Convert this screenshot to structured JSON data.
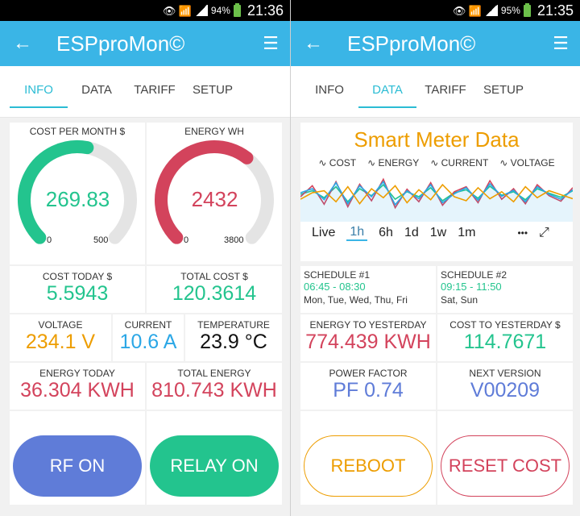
{
  "status_left": {
    "battery": "94%",
    "time": "21:36"
  },
  "status_right": {
    "battery": "95%",
    "time": "21:35"
  },
  "app": {
    "title": "ESPproMon©",
    "back_icon": "←",
    "menu_icon": "☰"
  },
  "tabs": [
    "INFO",
    "DATA",
    "TARIFF",
    "SETUP"
  ],
  "left": {
    "active_tab": "INFO",
    "gauge_cost": {
      "label": "COST PER MONTH $",
      "value": "269.83",
      "min": "0",
      "max": "500",
      "level": 0.54,
      "color": "#23c48e"
    },
    "gauge_energy": {
      "label": "ENERGY WH",
      "value": "2432",
      "min": "0",
      "max": "3800",
      "level": 0.64,
      "color": "#d3435c"
    },
    "cost_today": {
      "label": "COST TODAY $",
      "value": "5.5943"
    },
    "total_cost": {
      "label": "TOTAL COST $",
      "value": "120.3614"
    },
    "voltage": {
      "label": "VOLTAGE",
      "value": "234.1 V"
    },
    "current": {
      "label": "CURRENT",
      "value": "10.6 A"
    },
    "temperature": {
      "label": "TEMPERATURE",
      "value": "23.9 °C"
    },
    "energy_today": {
      "label": "ENERGY TODAY",
      "value": "36.304 KWH"
    },
    "total_energy": {
      "label": "TOTAL ENERGY",
      "value": "810.743 KWH"
    },
    "btn_rf": "RF ON",
    "btn_relay": "RELAY ON"
  },
  "right": {
    "active_tab": "DATA",
    "chart_title": "Smart Meter Data",
    "range_options": [
      "Live",
      "1h",
      "6h",
      "1d",
      "1w",
      "1m"
    ],
    "range_selected": "1h",
    "more_icon": "•••",
    "expand_icon": "⤢",
    "schedule1": {
      "label": "SCHEDULE #1",
      "time": "06:45 - 08:30",
      "days": "Mon, Tue, Wed, Thu, Fri"
    },
    "schedule2": {
      "label": "SCHEDULE #2",
      "time": "09:15 - 11:50",
      "days": "Sat, Sun"
    },
    "energy_yesterday": {
      "label": "ENERGY TO YESTERDAY",
      "value": "774.439 KWH"
    },
    "cost_yesterday": {
      "label": "COST TO YESTERDAY $",
      "value": "114.7671"
    },
    "power_factor": {
      "label": "POWER FACTOR",
      "value": "PF 0.74"
    },
    "next_version": {
      "label": "NEXT VERSION",
      "value": "V00209"
    },
    "btn_reboot": "REBOOT",
    "btn_reset": "RESET COST"
  },
  "colors": {
    "accent": "#3ab5e6",
    "green": "#23c48e",
    "red": "#d3435c",
    "orange": "#ed9d00",
    "blue": "#2ba7e6",
    "indigo": "#5f7cd8"
  },
  "chart_data": {
    "type": "line",
    "title": "Smart Meter Data",
    "series": [
      {
        "name": "COST",
        "color": "#23c48e",
        "values": [
          0.55,
          0.62,
          0.48,
          0.7,
          0.4,
          0.66,
          0.52,
          0.74,
          0.45,
          0.6,
          0.5,
          0.68,
          0.42,
          0.58,
          0.64,
          0.47,
          0.71,
          0.53,
          0.6,
          0.44,
          0.66,
          0.57,
          0.49,
          0.62
        ]
      },
      {
        "name": "ENERGY",
        "color": "#d3435c",
        "values": [
          0.5,
          0.72,
          0.35,
          0.8,
          0.3,
          0.75,
          0.42,
          0.85,
          0.28,
          0.65,
          0.4,
          0.78,
          0.33,
          0.6,
          0.7,
          0.38,
          0.82,
          0.45,
          0.66,
          0.36,
          0.74,
          0.52,
          0.41,
          0.68
        ]
      },
      {
        "name": "CURRENT",
        "color": "#2ba7e6",
        "values": [
          0.58,
          0.66,
          0.44,
          0.78,
          0.36,
          0.72,
          0.5,
          0.8,
          0.34,
          0.62,
          0.46,
          0.74,
          0.38,
          0.56,
          0.68,
          0.43,
          0.76,
          0.51,
          0.63,
          0.4,
          0.7,
          0.55,
          0.45,
          0.64
        ]
      },
      {
        "name": "VOLTAGE",
        "color": "#ed9d00",
        "values": [
          0.45,
          0.58,
          0.62,
          0.4,
          0.7,
          0.36,
          0.66,
          0.48,
          0.72,
          0.38,
          0.64,
          0.44,
          0.74,
          0.5,
          0.42,
          0.68,
          0.46,
          0.6,
          0.4,
          0.7,
          0.48,
          0.62,
          0.54,
          0.46
        ]
      }
    ]
  }
}
